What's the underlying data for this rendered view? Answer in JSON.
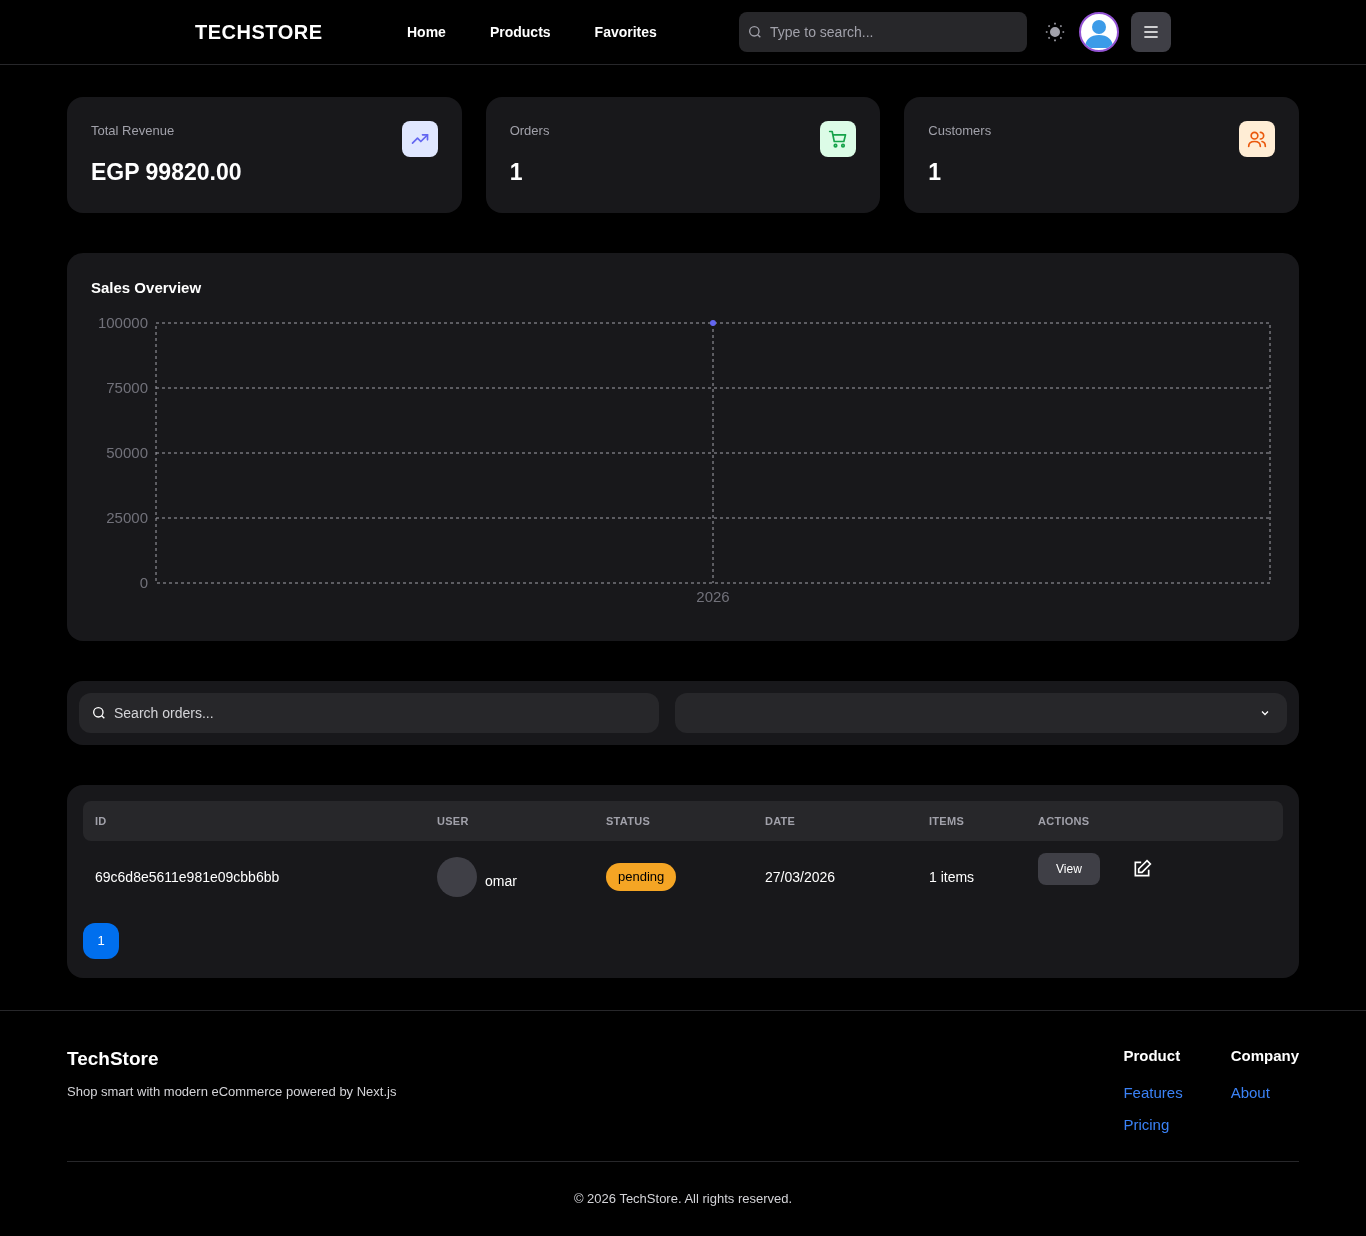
{
  "header": {
    "logo": "TECHSTORE",
    "nav": [
      {
        "label": "Home"
      },
      {
        "label": "Products"
      },
      {
        "label": "Favorites"
      }
    ],
    "search": {
      "placeholder": "Type to search..."
    }
  },
  "stats": [
    {
      "label": "Total Revenue",
      "value": "EGP 99820.00",
      "kind": "trend"
    },
    {
      "label": "Orders",
      "value": "1",
      "kind": "cart"
    },
    {
      "label": "Customers",
      "value": "1",
      "kind": "users"
    }
  ],
  "sales_overview": {
    "title": "Sales Overview",
    "chart_data": {
      "type": "line",
      "categories": [
        "2026"
      ],
      "series": [
        {
          "color": "#6366f1",
          "values": [
            100000
          ],
          "marker": true
        }
      ],
      "grid": true,
      "ylim": [
        0,
        100000
      ],
      "yticks": [
        0,
        25000,
        50000,
        75000,
        100000
      ]
    }
  },
  "filters": {
    "search": {
      "placeholder": "Search orders..."
    }
  },
  "orders_table": {
    "columns": [
      "ID",
      "USER",
      "STATUS",
      "DATE",
      "ITEMS",
      "ACTIONS"
    ],
    "rows": [
      {
        "id": "69c6d8e5611e981e09cbb6bb",
        "user": "omar",
        "status": "pending",
        "color": "#f5a524",
        "date": "27/03/2026",
        "items": "1 items",
        "action": "View"
      }
    ],
    "pages": [
      {
        "label": "1",
        "selected": true
      }
    ]
  },
  "footer": {
    "brand": "TechStore",
    "tagline": "Shop smart with modern eCommerce powered by Next.js",
    "columns": [
      {
        "title": "Product",
        "links": [
          "Features",
          "Pricing"
        ]
      },
      {
        "title": "Company",
        "links": [
          "About"
        ]
      }
    ],
    "copyright": "© 2026 TechStore. All rights reserved."
  }
}
